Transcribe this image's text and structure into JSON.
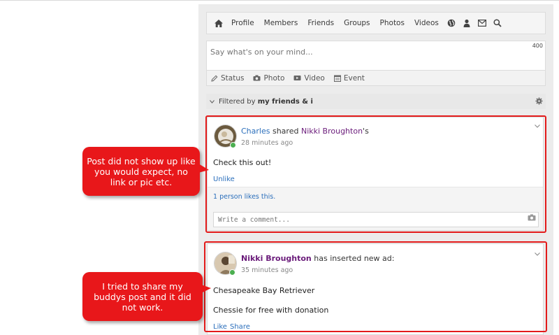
{
  "nav": {
    "items": [
      {
        "label": "Profile"
      },
      {
        "label": "Members"
      },
      {
        "label": "Friends"
      },
      {
        "label": "Groups"
      },
      {
        "label": "Photos"
      },
      {
        "label": "Videos"
      }
    ],
    "icons": [
      "home-icon",
      "globe-icon",
      "friend-requests-icon",
      "mail-icon",
      "search-icon"
    ]
  },
  "composer": {
    "placeholder": "Say what's on your mind...",
    "char_counter": "400",
    "tabs": [
      {
        "label": "Status",
        "icon": "pencil-icon"
      },
      {
        "label": "Photo",
        "icon": "camera-icon"
      },
      {
        "label": "Video",
        "icon": "video-icon"
      },
      {
        "label": "Event",
        "icon": "calendar-icon"
      }
    ]
  },
  "filter": {
    "prefix": "Filtered by",
    "value": "my friends & i"
  },
  "posts": [
    {
      "author": "Charles",
      "action": "shared",
      "target": "Nikki Broughton",
      "target_suffix": "'s",
      "time": "28 minutes ago",
      "body": "Check this out!",
      "like_action": "Unlike",
      "likes": "1 person likes this.",
      "comment_placeholder": "Write a comment..."
    },
    {
      "author": "Nikki Broughton",
      "action": "has inserted new ad:",
      "time": "35 minutes ago",
      "ad_title": "Chesapeake Bay Retriever",
      "body": "Chessie for free with donation",
      "like_action": "Like",
      "share_action": "Share"
    }
  ],
  "callouts": [
    {
      "text": "Post did not show up like you would expect, no link or pic etc."
    },
    {
      "text": "I tried to share my buddys post and it did not work."
    }
  ],
  "colors": {
    "annotation_red": "#e31b1b",
    "link_blue": "#2a6ebb",
    "name_purple": "#6a1b7a",
    "online_green": "#4caf50"
  }
}
